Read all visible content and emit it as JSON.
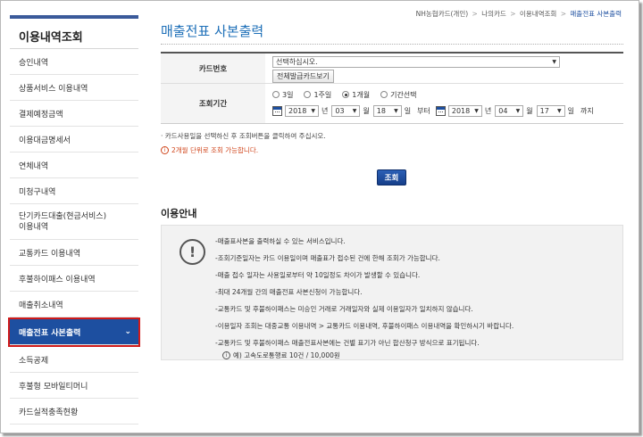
{
  "sidebar": {
    "title": "이용내역조회",
    "items": [
      {
        "label": "승인내역"
      },
      {
        "label": "상품서비스 이용내역"
      },
      {
        "label": "결제예정금액"
      },
      {
        "label": "이용대금명세서"
      },
      {
        "label": "연체내역"
      },
      {
        "label": "미청구내역"
      },
      {
        "label": "단기카드대출(현금서비스)\n이용내역"
      },
      {
        "label": "교통카드 이용내역"
      },
      {
        "label": "후불하이패스 이용내역"
      },
      {
        "label": "매출취소내역"
      },
      {
        "label": "매출전표 사본출력",
        "active": true
      },
      {
        "label": "소득공제"
      },
      {
        "label": "후불형 모바일티머니"
      },
      {
        "label": "카드실적충족현황"
      }
    ],
    "active_chevron": "⌄"
  },
  "breadcrumb": {
    "items": [
      "NH농협카드(개인)",
      "나의카드",
      "이용내역조회",
      "매출전표 사본출력"
    ],
    "separator": ">"
  },
  "page_title": "매출전표 사본출력",
  "form": {
    "card_label": "카드번호",
    "card_select": "선택하십시오.",
    "card_all_button": "전체발급카드보기",
    "period_label": "조회기간",
    "period_options": [
      {
        "label": "3일",
        "selected": false
      },
      {
        "label": "1주일",
        "selected": false
      },
      {
        "label": "1개월",
        "selected": true
      },
      {
        "label": "기간선택",
        "selected": false
      }
    ],
    "from": {
      "year": "2018",
      "month": "03",
      "day": "18"
    },
    "to": {
      "year": "2018",
      "month": "04",
      "day": "17"
    },
    "unit_year": "년",
    "unit_month": "월",
    "unit_day": "일",
    "from_suffix": "부터",
    "to_suffix": "까지"
  },
  "notes": {
    "note1": "· 카드사용일을 선택하신 후 조회버튼을 클릭하여 주십시오.",
    "note2": "2개월 단위로 조회 가능합니다.",
    "info_glyph": "i"
  },
  "search_button": "조회",
  "guide": {
    "title": "이용안내",
    "icon_glyph": "!",
    "lines": [
      "-매출표사본을 출력하실 수 있는 서비스입니다.",
      "-조회기준일자는 카드 이용일이며 매출표가 접수된 건에 한해 조회가 가능합니다.",
      "-매출 접수 일자는 사용일로부터 약 10일정도 차이가 발생할 수 있습니다.",
      "-최대 24개월 간의 매출전표 사본신청이 가능합니다.",
      "-교통카드 및 후불하이패스는 미승인 거래로 거래일자와 실제 이용일자가 일치하지 않습니다.",
      "-이용일자 조회는 대중교통 이용내역 > 교통카드 이용내역, 후불하이패스 이용내역을 확인하시기 바랍니다.",
      "-교통카드 및 후불하이패스 매출전표사본에는 건별 표기가 아닌 합산청구 방식으로 표기됩니다."
    ],
    "example": "예) 고속도로통행료 10건 / 10,000원",
    "example_glyph": "i"
  },
  "colors": {
    "accent": "#1d4fa0",
    "title": "#1d6fb8",
    "warning": "#d0451b",
    "highlight_outline": "#d01a1a"
  }
}
